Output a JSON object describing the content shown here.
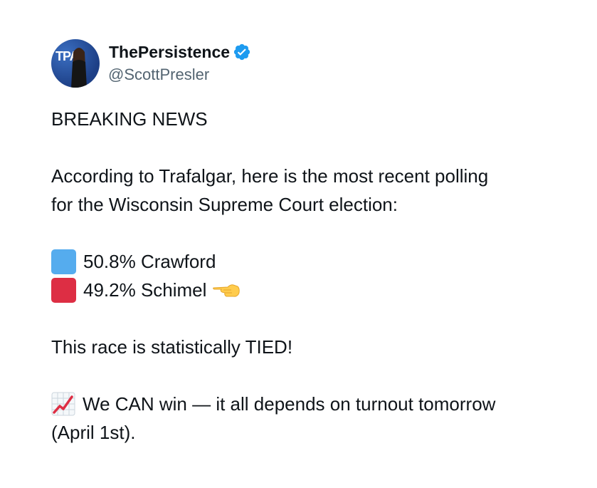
{
  "author": {
    "display_name": "ThePersistence",
    "handle": "@ScottPresler",
    "avatar_logo_text": "TPA"
  },
  "colors": {
    "verified_badge": "#1d9bf0",
    "blue_square": "#55acee",
    "red_square": "#dd2e44"
  },
  "tweet": {
    "headline": "BREAKING NEWS",
    "intro_line1": "According to Trafalgar, here is the most recent polling",
    "intro_line2": "for the Wisconsin Supreme Court election:",
    "poll": [
      {
        "swatch": "blue-square-emoji",
        "text": "50.8% Crawford"
      },
      {
        "swatch": "red-square-emoji",
        "text": "49.2% Schimel",
        "trailing_icon": "backhand-index-pointing-left-emoji"
      }
    ],
    "tied_line": "This race is statistically TIED!",
    "cta_icon": "chart-increasing-emoji",
    "cta_line1": "We CAN win — it all depends on turnout tomorrow",
    "cta_line2": "(April 1st)."
  }
}
